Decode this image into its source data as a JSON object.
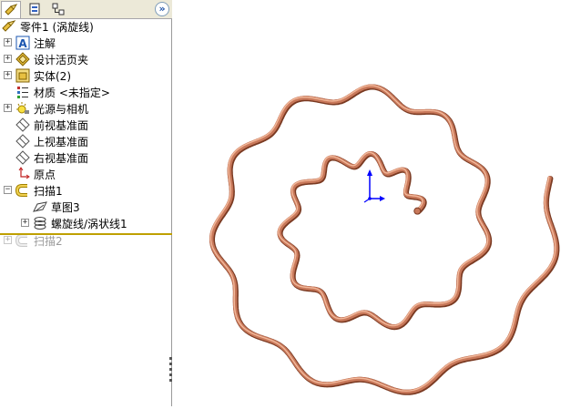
{
  "feature_tree": {
    "tabs": [
      {
        "name": "feature-manager-tab-icon",
        "selected": true
      },
      {
        "name": "property-manager-tab-icon",
        "selected": false
      },
      {
        "name": "configuration-manager-tab-icon",
        "selected": false
      }
    ],
    "expand_glyph": "»",
    "part_label": "零件1  (涡旋线)",
    "items": [
      {
        "label": "注解",
        "icon": "annotation-icon",
        "expander": "+"
      },
      {
        "label": "设计活页夹",
        "icon": "design-binder-icon",
        "expander": "+"
      },
      {
        "label": "实体(2)",
        "icon": "solid-bodies-icon",
        "expander": "+"
      },
      {
        "label": "材质 <未指定>",
        "icon": "material-icon",
        "expander": ""
      },
      {
        "label": "光源与相机",
        "icon": "lights-cameras-icon",
        "expander": "+"
      },
      {
        "label": "前视基准面",
        "icon": "plane-icon",
        "expander": ""
      },
      {
        "label": "上视基准面",
        "icon": "plane-icon",
        "expander": ""
      },
      {
        "label": "右视基准面",
        "icon": "plane-icon",
        "expander": ""
      },
      {
        "label": "原点",
        "icon": "origin-icon",
        "expander": ""
      },
      {
        "label": "扫描1",
        "icon": "sweep-icon",
        "expander": "−"
      },
      {
        "label": "草图3",
        "icon": "sketch-icon",
        "expander": ""
      },
      {
        "label": "螺旋线/涡状线1",
        "icon": "helix-icon",
        "expander": "+"
      },
      {
        "label": "扫描2",
        "icon": "sweep-icon",
        "expander": "+",
        "dimmed": true
      }
    ]
  },
  "viewport": {
    "model_color": "#c8785a",
    "highlight_color": "#f2b89a",
    "shadow_color": "#7a3a22",
    "triad_color": "#0000ff"
  }
}
